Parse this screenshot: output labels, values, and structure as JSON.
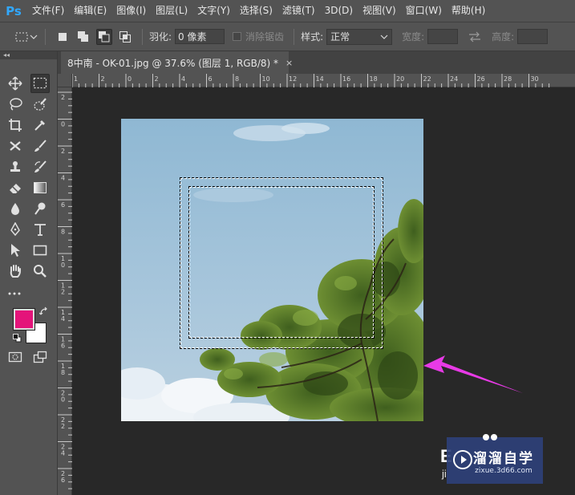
{
  "app": {
    "logo": "Ps"
  },
  "menu": [
    "文件(F)",
    "编辑(E)",
    "图像(I)",
    "图层(L)",
    "文字(Y)",
    "选择(S)",
    "滤镜(T)",
    "3D(D)",
    "视图(V)",
    "窗口(W)",
    "帮助(H)"
  ],
  "options": {
    "feather_label": "羽化:",
    "feather_value": "0 像素",
    "antialias_label": "消除锯齿",
    "style_label": "样式:",
    "style_value": "正常",
    "width_label": "宽度:",
    "height_label": "高度:"
  },
  "tab": {
    "title": "8中南 - OK-01.jpg @ 37.6% (图层 1, RGB/8) *",
    "close": "×"
  },
  "panel": {
    "collapse": "◂◂"
  },
  "ruler_h": [
    "1",
    "2",
    "0",
    "2",
    "4",
    "6",
    "8",
    "10",
    "12",
    "14",
    "16",
    "18",
    "20",
    "22",
    "24",
    "26",
    "28",
    "30"
  ],
  "ruler_v": [
    "2",
    "0",
    "2",
    "4",
    "6",
    "8",
    "1 0",
    "1 2",
    "1 4",
    "1 6",
    "1 8",
    "2 0",
    "2 2",
    "2 4",
    "2 6"
  ],
  "colors": {
    "foreground": "#e4147a",
    "background": "#ffffff",
    "annotation_arrow": "#e83ae6",
    "ps_blue": "#31a8ff"
  },
  "watermark": {
    "brand": "溜溜自学",
    "url": "zixue.3d66.com",
    "side_char": "E",
    "side_text": "ji"
  }
}
